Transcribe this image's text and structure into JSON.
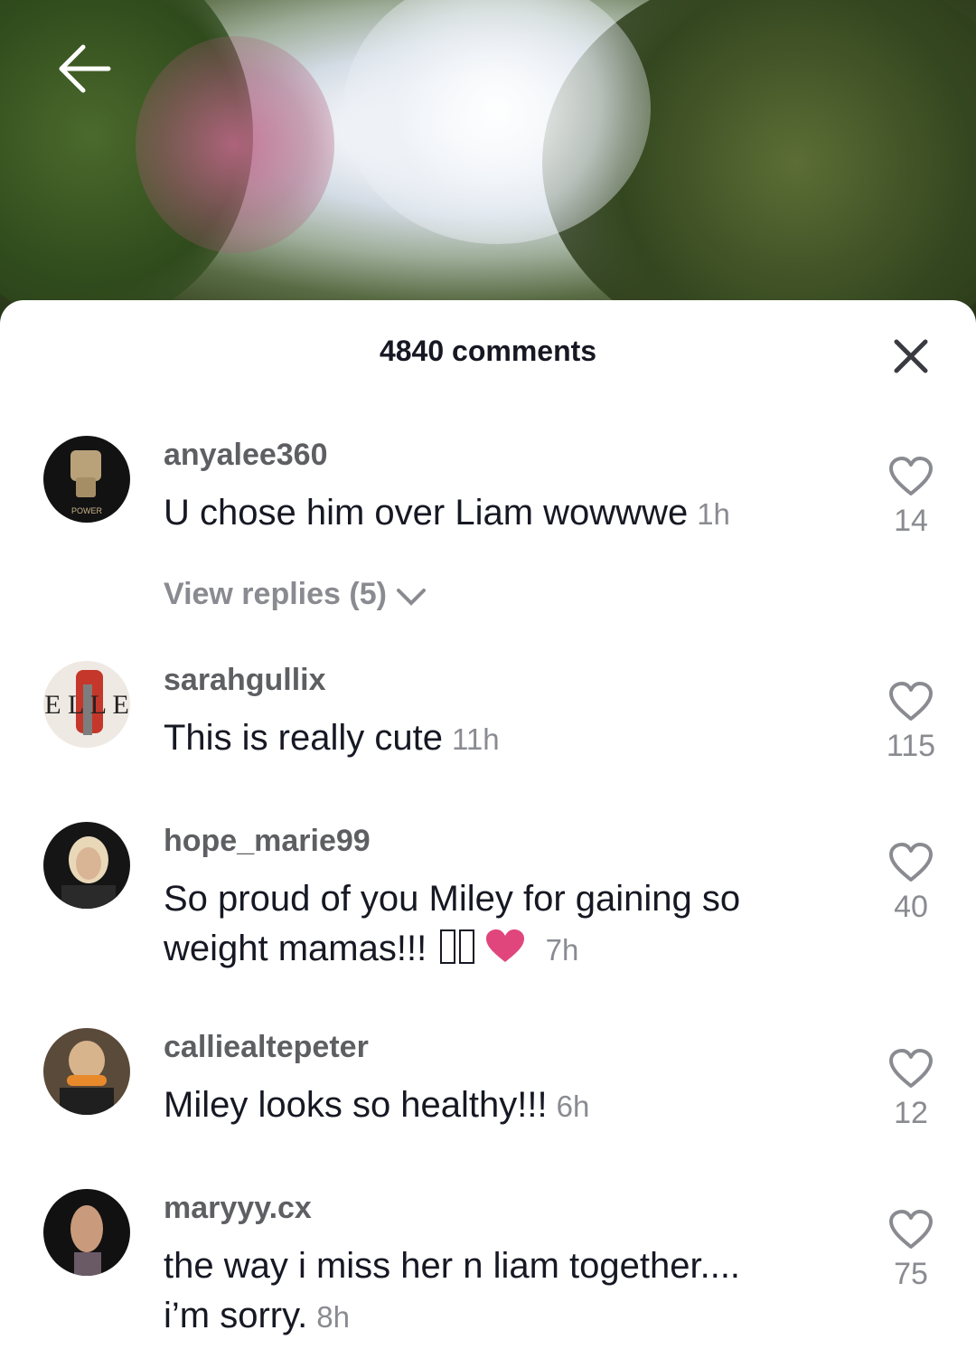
{
  "header": {
    "back_icon": "arrow-left-icon",
    "comment_count_title": "4840 comments",
    "close_icon": "close-icon"
  },
  "comments": [
    {
      "username": "anyalee360",
      "text": "U chose him over Liam wowwwe",
      "time": "1h",
      "likes": "14",
      "avatar_label": "POWER",
      "view_replies": "View replies (5)"
    },
    {
      "username": "sarahgullix",
      "text": "This is really cute",
      "time": "11h",
      "likes": "115",
      "avatar_label": "E L L E"
    },
    {
      "username": "hope_marie99",
      "text_line1": "So proud of you Miley for gaining so",
      "text_line2": "weight mamas!!!",
      "time": "7h",
      "likes": "40"
    },
    {
      "username": "calliealtepeter",
      "text": "Miley looks so healthy!!!",
      "time": "6h",
      "likes": "12"
    },
    {
      "username": "maryyy.cx",
      "text_line1": "the way i miss her n liam together....",
      "text_line2": "i’m sorry.",
      "time": "8h",
      "likes": "75"
    }
  ],
  "colors": {
    "heart_emoji": "#e0467c",
    "muted_text": "#8a8b91",
    "primary_text": "#161823"
  }
}
